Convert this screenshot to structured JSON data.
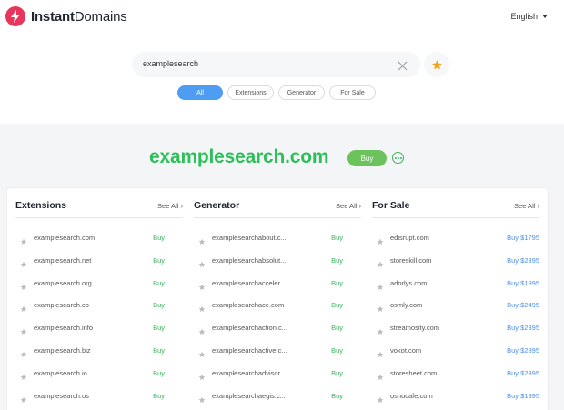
{
  "header": {
    "logo_bold": "Instant",
    "logo_thin": "Domains",
    "language": "English"
  },
  "search": {
    "query": "examplesearch"
  },
  "filters": [
    "All",
    "Extensions",
    "Generator",
    "For Sale"
  ],
  "hero": {
    "domain": "examplesearch.com",
    "buy_label": "Buy"
  },
  "columns": {
    "extensions": {
      "title": "Extensions",
      "see_all": "See All",
      "rows": [
        {
          "name": "examplesearch.com",
          "action": "Buy"
        },
        {
          "name": "examplesearch.net",
          "action": "Buy"
        },
        {
          "name": "examplesearch.org",
          "action": "Buy"
        },
        {
          "name": "examplesearch.co",
          "action": "Buy"
        },
        {
          "name": "examplesearch.info",
          "action": "Buy"
        },
        {
          "name": "examplesearch.biz",
          "action": "Buy"
        },
        {
          "name": "examplesearch.io",
          "action": "Buy"
        },
        {
          "name": "examplesearch.us",
          "action": "Buy"
        }
      ]
    },
    "generator": {
      "title": "Generator",
      "see_all": "See All",
      "rows": [
        {
          "name": "examplesearchabout.c...",
          "action": "Buy"
        },
        {
          "name": "examplesearchabsolut...",
          "action": "Buy"
        },
        {
          "name": "examplesearchacceler...",
          "action": "Buy"
        },
        {
          "name": "examplesearchace.com",
          "action": "Buy"
        },
        {
          "name": "examplesearchaction.c...",
          "action": "Buy"
        },
        {
          "name": "examplesearchactive.c...",
          "action": "Buy"
        },
        {
          "name": "examplesearchadvisor...",
          "action": "Buy"
        },
        {
          "name": "examplesearchaegis.c...",
          "action": "Buy"
        }
      ]
    },
    "for_sale": {
      "title": "For Sale",
      "see_all": "See All",
      "rows": [
        {
          "name": "edisrupt.com",
          "action": "Buy $1795"
        },
        {
          "name": "storeskill.com",
          "action": "Buy $2395"
        },
        {
          "name": "adorlys.com",
          "action": "Buy $1895"
        },
        {
          "name": "osmly.com",
          "action": "Buy $2495"
        },
        {
          "name": "streamosity.com",
          "action": "Buy $2395"
        },
        {
          "name": "vokot.com",
          "action": "Buy $2895"
        },
        {
          "name": "storesheet.com",
          "action": "Buy $2395"
        },
        {
          "name": "oshocafe.com",
          "action": "Buy $1995"
        }
      ]
    }
  },
  "colors": {
    "brand_red": "#e8355b",
    "accent_blue": "#4f9cf3",
    "domain_green": "#2fbf5a",
    "star_orange": "#f2a21b"
  }
}
